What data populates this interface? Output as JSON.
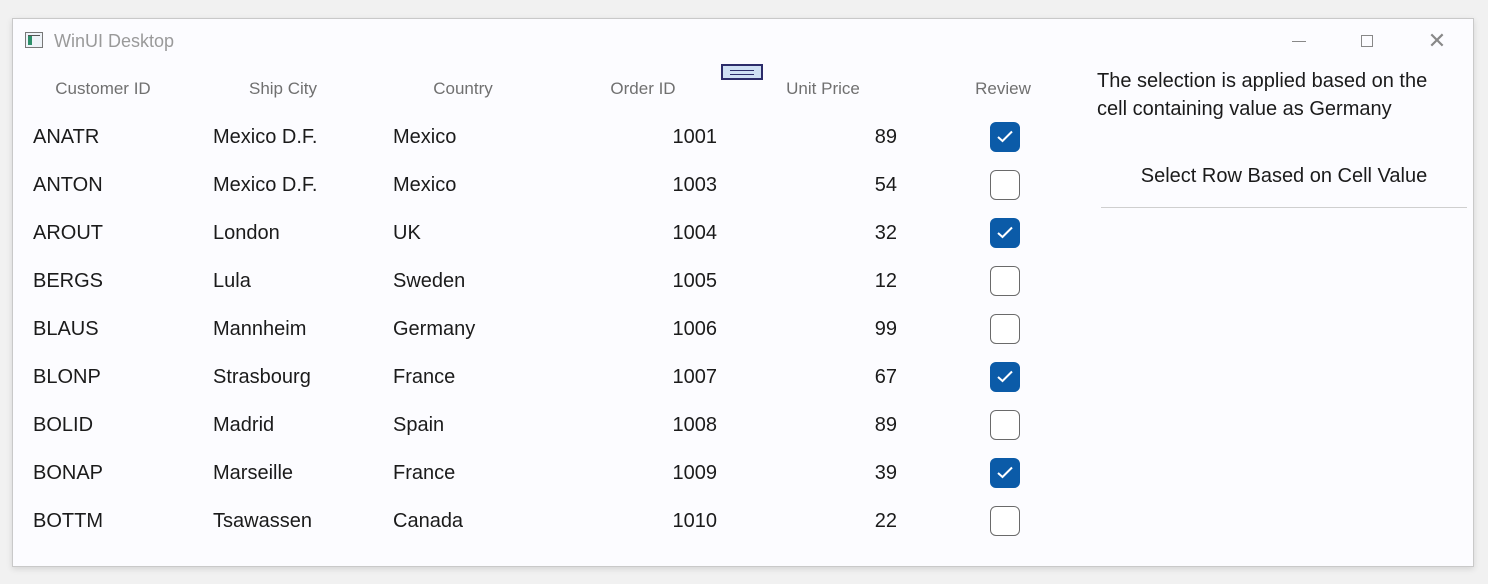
{
  "window": {
    "title": "WinUI Desktop"
  },
  "grid": {
    "columns": [
      "Customer ID",
      "Ship City",
      "Country",
      "Order ID",
      "Unit Price",
      "Review"
    ],
    "rows": [
      {
        "customer_id": "ANATR",
        "ship_city": "Mexico D.F.",
        "country": "Mexico",
        "order_id": "1001",
        "unit_price": "89",
        "review": true
      },
      {
        "customer_id": "ANTON",
        "ship_city": "Mexico D.F.",
        "country": "Mexico",
        "order_id": "1003",
        "unit_price": "54",
        "review": false
      },
      {
        "customer_id": "AROUT",
        "ship_city": "London",
        "country": "UK",
        "order_id": "1004",
        "unit_price": "32",
        "review": true
      },
      {
        "customer_id": "BERGS",
        "ship_city": "Lula",
        "country": "Sweden",
        "order_id": "1005",
        "unit_price": "12",
        "review": false
      },
      {
        "customer_id": "BLAUS",
        "ship_city": "Mannheim",
        "country": "Germany",
        "order_id": "1006",
        "unit_price": "99",
        "review": false
      },
      {
        "customer_id": "BLONP",
        "ship_city": "Strasbourg",
        "country": "France",
        "order_id": "1007",
        "unit_price": "67",
        "review": true
      },
      {
        "customer_id": "BOLID",
        "ship_city": "Madrid",
        "country": "Spain",
        "order_id": "1008",
        "unit_price": "89",
        "review": false
      },
      {
        "customer_id": "BONAP",
        "ship_city": "Marseille",
        "country": "France",
        "order_id": "1009",
        "unit_price": "39",
        "review": true
      },
      {
        "customer_id": "BOTTM",
        "ship_city": "Tsawassen",
        "country": "Canada",
        "order_id": "1010",
        "unit_price": "22",
        "review": false
      }
    ]
  },
  "panel": {
    "description": "The selection is applied based on the cell containing value as Germany",
    "button_label": "Select Row Based on Cell Value"
  },
  "colors": {
    "checkbox_checked": "#0b5ba8",
    "accent": "#0b5ba8"
  }
}
